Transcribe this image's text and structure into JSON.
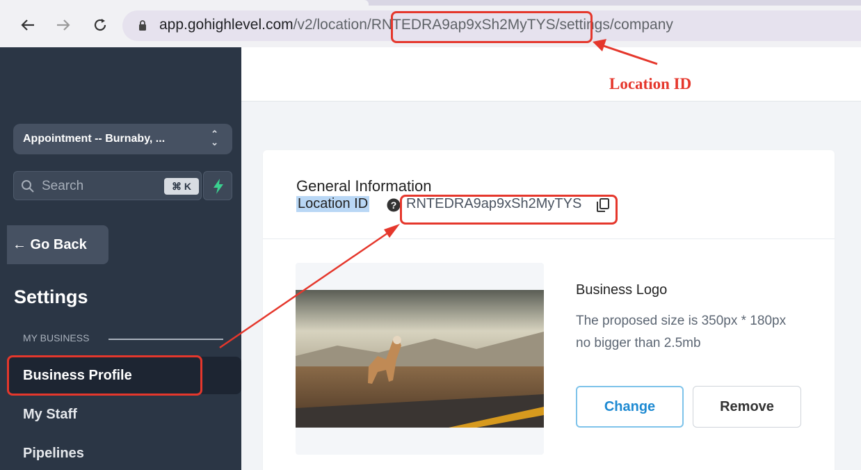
{
  "browser": {
    "url_host": "app.gohighlevel.com",
    "url_path_start": "/v2/location/",
    "url_location_id": "RNTEDRA9ap9xSh2MyTYS",
    "url_path_end": "/settings/company"
  },
  "annotations": {
    "location_id_label": "Location ID",
    "accent_color": "#e5372c"
  },
  "sidebar": {
    "location_name": "Appointment -- Burnaby, ...",
    "search_placeholder": "Search",
    "search_shortcut": "⌘ K",
    "go_back_label": "← Go Back",
    "settings_title": "Settings",
    "section_label": "MY BUSINESS",
    "items": [
      {
        "label": "Business Profile",
        "active": true
      },
      {
        "label": "My Staff"
      },
      {
        "label": "Pipelines"
      }
    ]
  },
  "main": {
    "general_info_title": "General Information",
    "location_id_label": "Location ID",
    "location_id_value": "RNTEDRA9ap9xSh2MyTYS",
    "business_logo": {
      "title": "Business Logo",
      "description_line1": "The proposed size is 350px * 180px",
      "description_line2": "no bigger than 2.5mb",
      "change_label": "Change",
      "remove_label": "Remove"
    }
  },
  "icons": [
    "back-arrow-icon",
    "forward-arrow-icon",
    "reload-icon",
    "lock-icon",
    "chevron-updown-icon",
    "search-icon",
    "bolt-icon",
    "help-icon",
    "copy-icon"
  ]
}
